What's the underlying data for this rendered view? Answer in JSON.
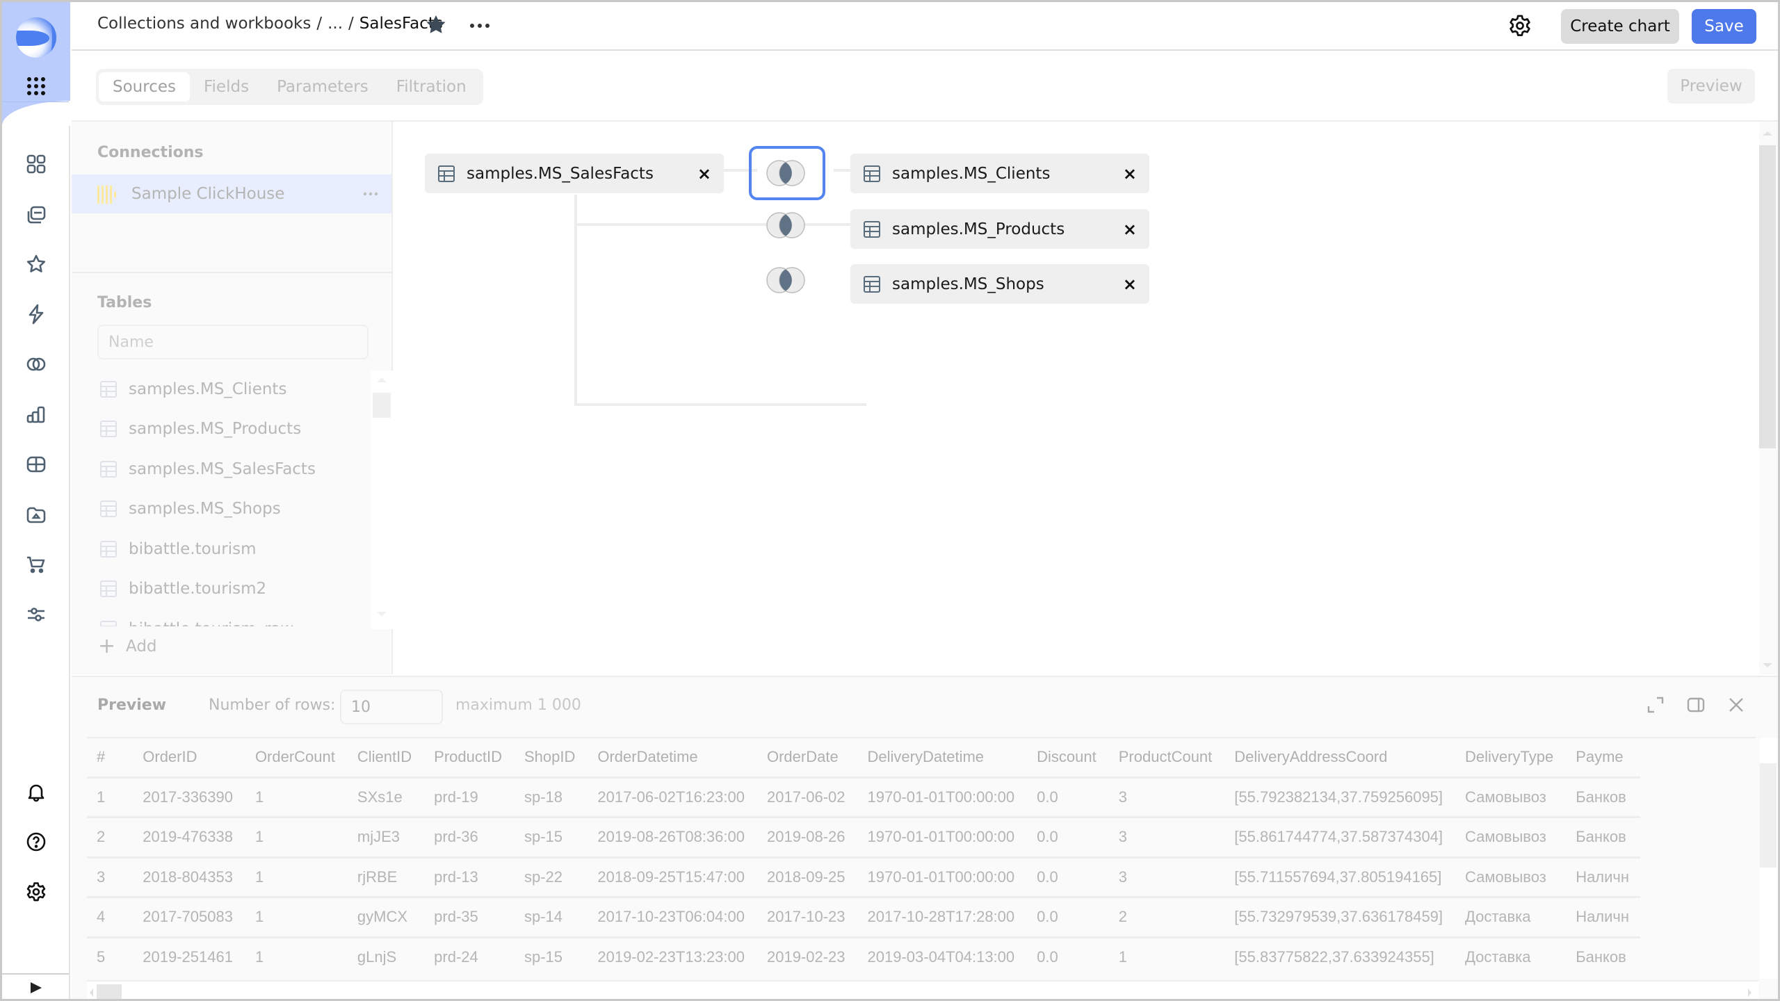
{
  "header": {
    "breadcrumb": [
      "Collections and workbooks",
      "...",
      "SalesFacts"
    ],
    "create_chart_label": "Create chart",
    "save_label": "Save"
  },
  "tabs": [
    {
      "label": "Sources",
      "active": true
    },
    {
      "label": "Fields",
      "active": false
    },
    {
      "label": "Parameters",
      "active": false
    },
    {
      "label": "Filtration",
      "active": false
    }
  ],
  "preview_button_label": "Preview",
  "left_panel": {
    "connections_title": "Connections",
    "connection": {
      "label": "Sample ClickHouse",
      "icon": "clickhouse-icon"
    },
    "tables_title": "Tables",
    "search_placeholder": "Name",
    "tables": [
      "samples.MS_Clients",
      "samples.MS_Products",
      "samples.MS_SalesFacts",
      "samples.MS_Shops",
      "bibattle.tourism",
      "bibattle.tourism2",
      "bibattle.tourism_raw"
    ],
    "add_label": "Add"
  },
  "join_diagram": {
    "root": "samples.MS_SalesFacts",
    "joined": [
      {
        "table": "samples.MS_Clients",
        "join_type": "inner",
        "selected": true
      },
      {
        "table": "samples.MS_Products",
        "join_type": "inner",
        "selected": false
      },
      {
        "table": "samples.MS_Shops",
        "join_type": "inner",
        "selected": false
      }
    ],
    "close_glyph": "×"
  },
  "preview": {
    "title": "Preview",
    "rows_label": "Number of rows:",
    "rows_value": "10",
    "rows_max": "maximum 1 000",
    "columns": [
      "#",
      "OrderID",
      "OrderCount",
      "ClientID",
      "ProductID",
      "ShopID",
      "OrderDatetime",
      "OrderDate",
      "DeliveryDatetime",
      "Discount",
      "ProductCount",
      "DeliveryAddressCoord",
      "DeliveryType",
      "Payme"
    ],
    "rows": [
      [
        "1",
        "2017-336390",
        "1",
        "SXs1e",
        "prd-19",
        "sp-18",
        "2017-06-02T16:23:00",
        "2017-06-02",
        "1970-01-01T00:00:00",
        "0.0",
        "3",
        "[55.792382134,37.759256095]",
        "Самовывоз",
        "Банков"
      ],
      [
        "2",
        "2019-476338",
        "1",
        "mjJE3",
        "prd-36",
        "sp-15",
        "2019-08-26T08:36:00",
        "2019-08-26",
        "1970-01-01T00:00:00",
        "0.0",
        "3",
        "[55.861744774,37.587374304]",
        "Самовывоз",
        "Банков"
      ],
      [
        "3",
        "2018-804353",
        "1",
        "rjRBE",
        "prd-13",
        "sp-22",
        "2018-09-25T15:47:00",
        "2018-09-25",
        "1970-01-01T00:00:00",
        "0.0",
        "3",
        "[55.711557694,37.805194165]",
        "Самовывоз",
        "Наличн"
      ],
      [
        "4",
        "2017-705083",
        "1",
        "gyMCX",
        "prd-35",
        "sp-14",
        "2017-10-23T06:04:00",
        "2017-10-23",
        "2017-10-28T17:28:00",
        "0.0",
        "2",
        "[55.732979539,37.636178459]",
        "Доставка",
        "Наличн"
      ],
      [
        "5",
        "2019-251461",
        "1",
        "gLnjS",
        "prd-24",
        "sp-15",
        "2019-02-23T13:23:00",
        "2019-02-23",
        "2019-03-04T04:13:00",
        "0.0",
        "1",
        "[55.83775822,37.633924355]",
        "Доставка",
        "Банков"
      ]
    ]
  },
  "colors": {
    "accent": "#4e79eb",
    "rail_top": "#b9ccfc",
    "selected_join_border": "#5384f0",
    "connection_highlight": "#e8eefd"
  }
}
